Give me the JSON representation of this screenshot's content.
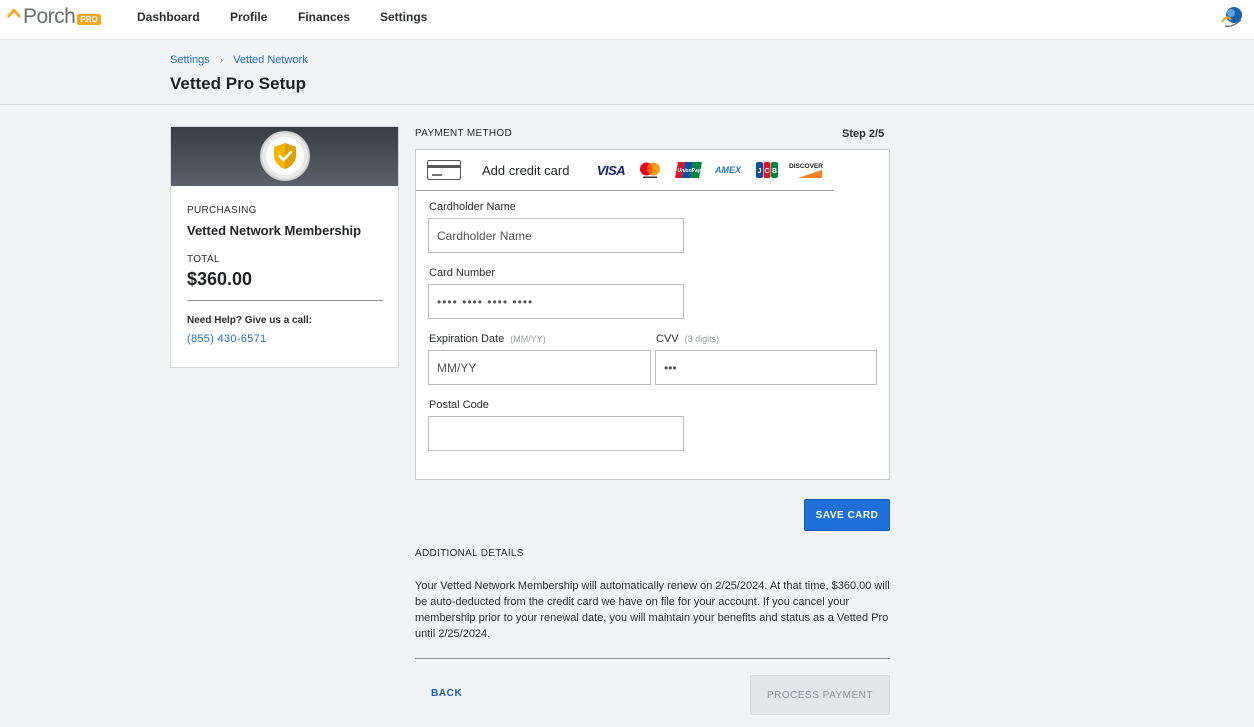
{
  "app": {
    "logo_text": "Porch",
    "logo_badge": "PRO"
  },
  "nav": {
    "items": [
      {
        "label": "Dashboard"
      },
      {
        "label": "Profile"
      },
      {
        "label": "Finances"
      },
      {
        "label": "Settings"
      }
    ]
  },
  "breadcrumb": {
    "items": [
      {
        "label": "Settings"
      },
      {
        "label": "Vetted Network"
      }
    ],
    "separator": "›"
  },
  "page": {
    "title": "Vetted Pro Setup"
  },
  "summary": {
    "purchasing_label": "PURCHASING",
    "product": "Vetted Network Membership",
    "total_label": "TOTAL",
    "total": "$360.00",
    "help_text": "Need Help? Give us a call:",
    "phone": "(855) 430-6571",
    "badge_icon": "shield-check-icon"
  },
  "payment": {
    "section_label": "PAYMENT METHOD",
    "step": "Step 2/5",
    "tab_label": "Add credit card",
    "brands": [
      {
        "name": "VISA",
        "icon": "visa-icon"
      },
      {
        "name": "mastercard",
        "icon": "mastercard-icon"
      },
      {
        "name": "UnionPay",
        "icon": "unionpay-icon"
      },
      {
        "name": "AMEX",
        "icon": "amex-icon"
      },
      {
        "name": "JCB",
        "icon": "jcb-icon"
      },
      {
        "name": "DISCOVER",
        "icon": "discover-icon"
      }
    ],
    "fields": {
      "cardholder": {
        "label": "Cardholder Name",
        "placeholder": "Cardholder Name",
        "value": ""
      },
      "card_number": {
        "label": "Card Number",
        "placeholder": "•••• •••• •••• ••••",
        "value": ""
      },
      "expiration": {
        "label": "Expiration Date",
        "hint": "(MM/YY)",
        "placeholder": "MM/YY",
        "value": ""
      },
      "cvv": {
        "label": "CVV",
        "hint": "(3 digits)",
        "placeholder": "•••",
        "value": ""
      },
      "postal": {
        "label": "Postal Code",
        "placeholder": "",
        "value": ""
      }
    },
    "save_label": "SAVE CARD"
  },
  "details": {
    "section_label": "ADDITIONAL DETAILS",
    "text": "Your Vetted Network Membership will automatically renew on 2/25/2024. At that time, $360.00 will be auto-deducted from the credit card we have on file for your account. If you cancel your membership prior to your renewal date, you will maintain your benefits and status as a Vetted Pro until 2/25/2024."
  },
  "actions": {
    "back_label": "BACK",
    "process_label": "PROCESS PAYMENT"
  },
  "colors": {
    "accent": "#1f6fd8",
    "link": "#2c6cc4",
    "brand_orange": "#f4a81d"
  }
}
